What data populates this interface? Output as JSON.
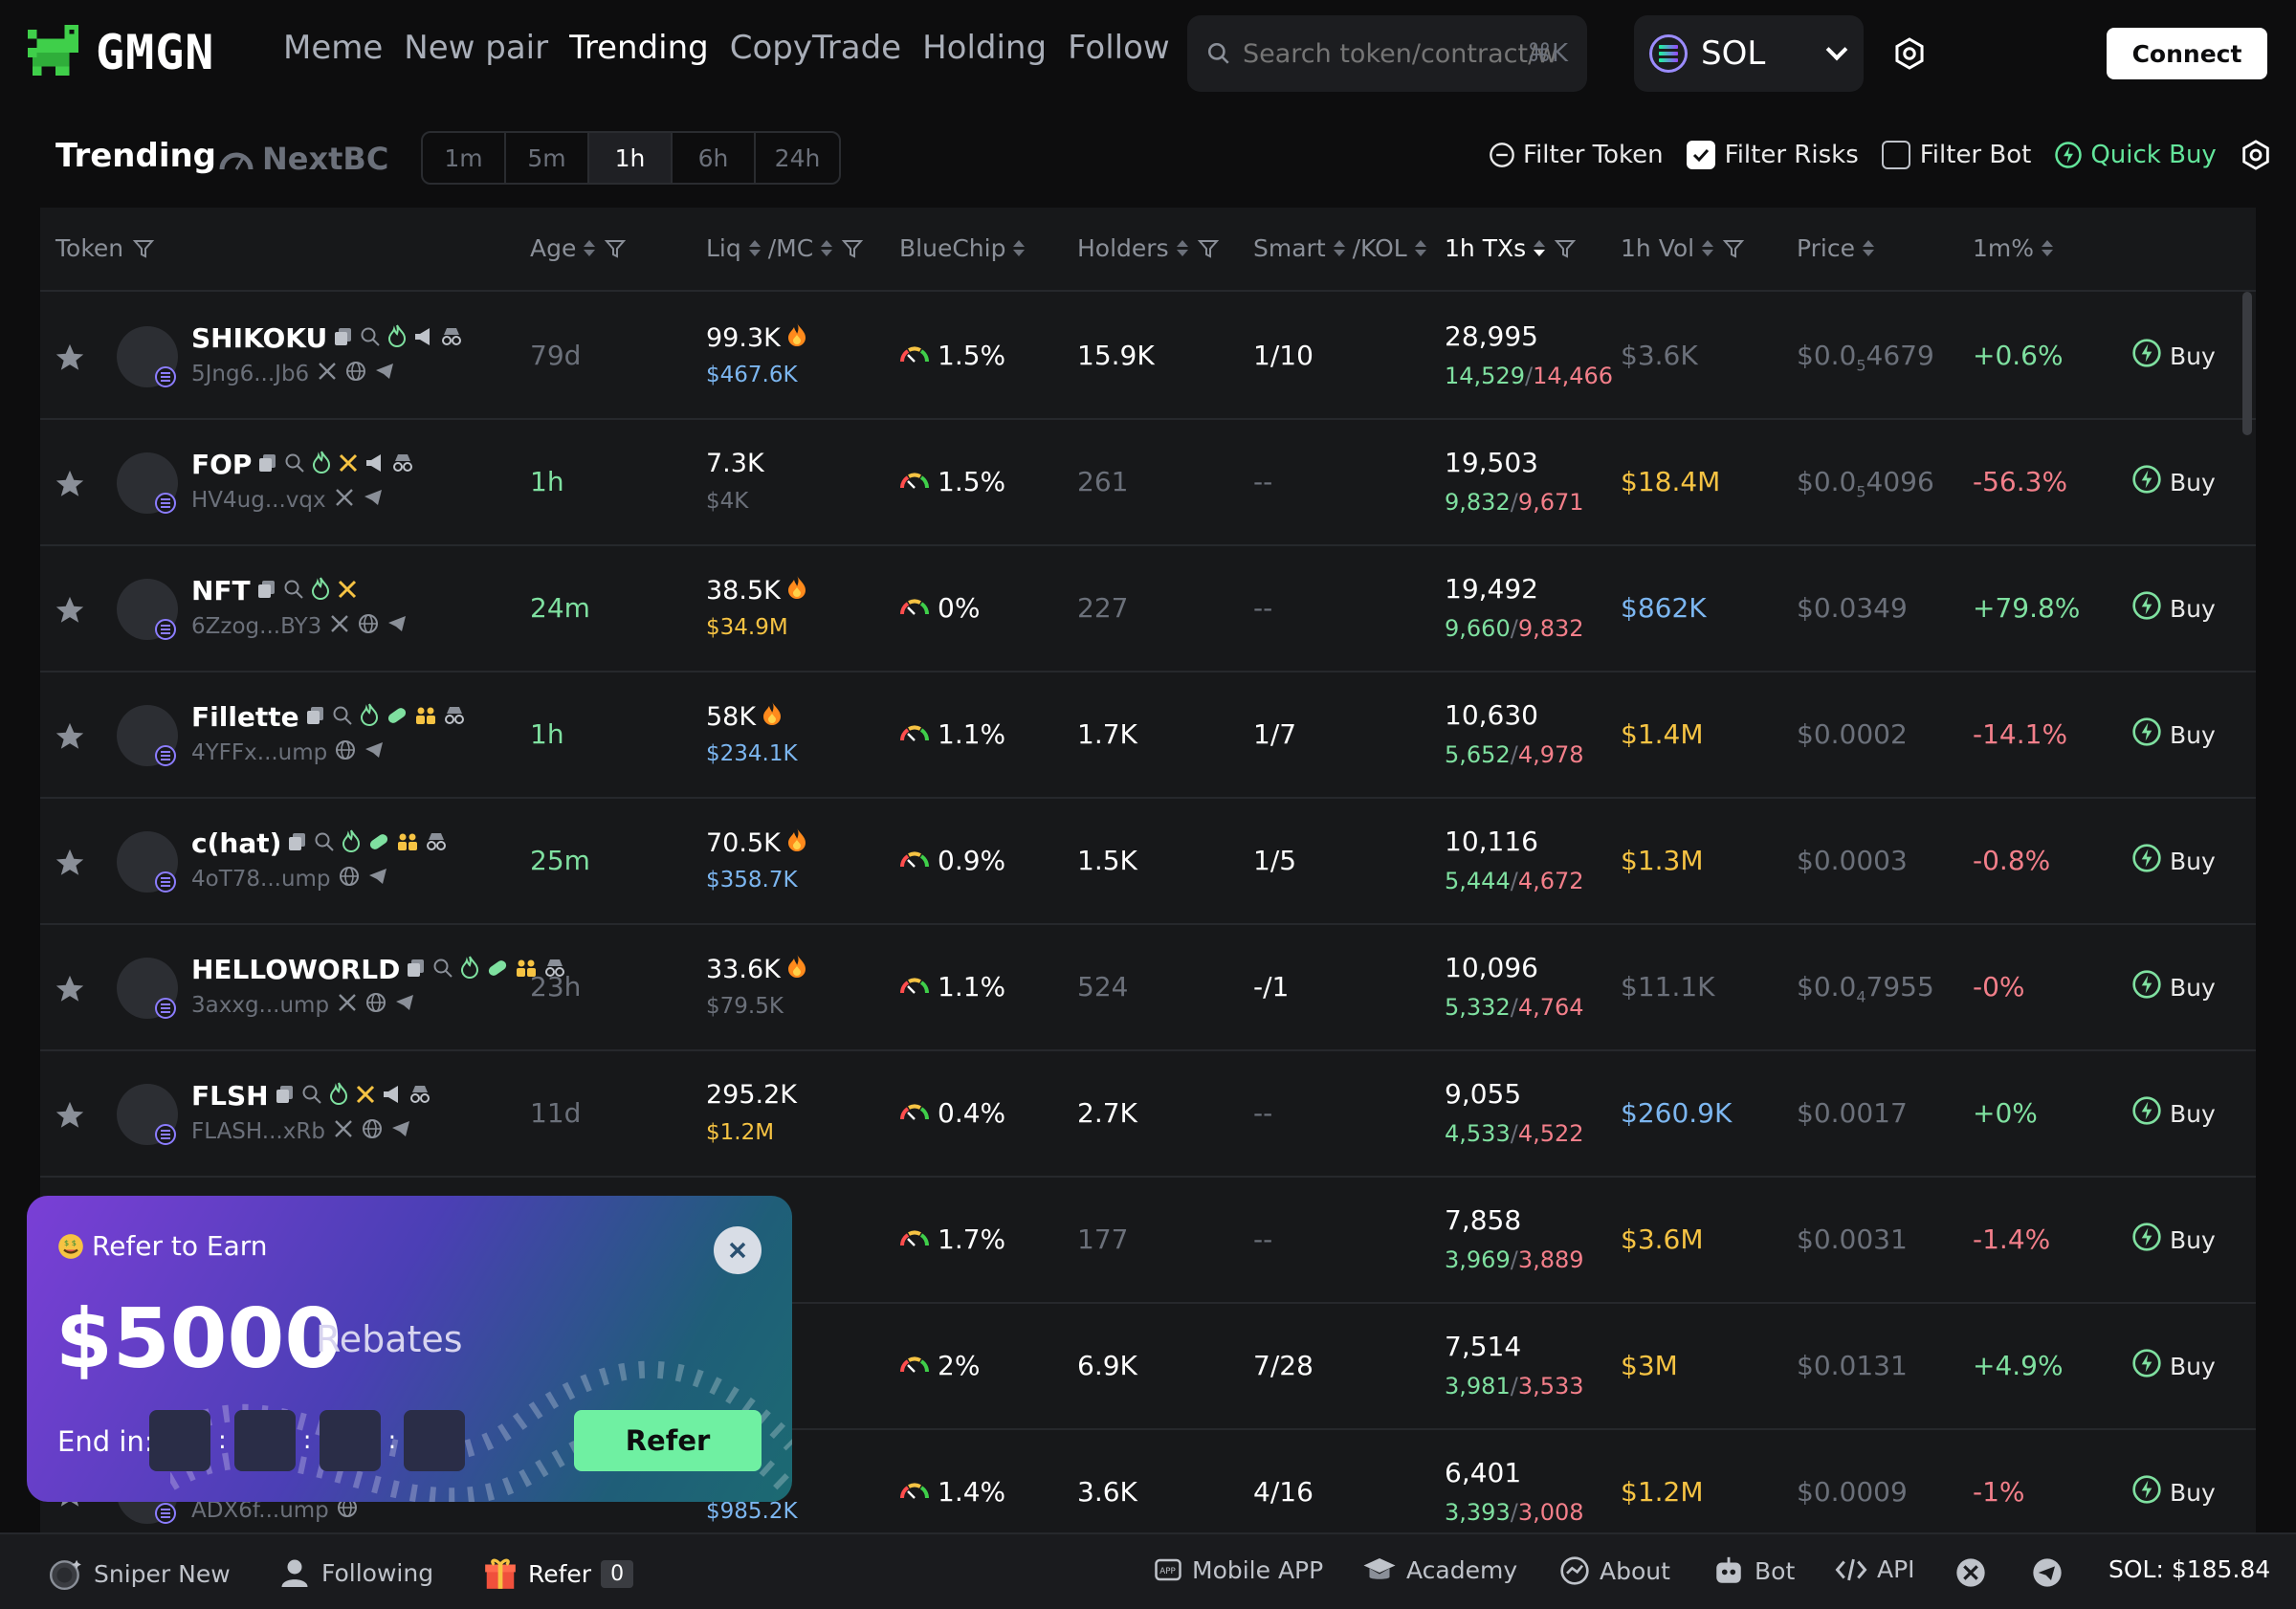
{
  "app": {
    "logo_text": "GMGN",
    "brand_green": "#3fcf4a"
  },
  "nav": {
    "links": [
      "Meme",
      "New pair",
      "Trending",
      "CopyTrade",
      "Holding",
      "Follow"
    ],
    "active": "Trending"
  },
  "search": {
    "placeholder": "Search token/contract/wallet",
    "shortcut": "⌘K"
  },
  "chain": {
    "name": "SOL"
  },
  "connect_label": "Connect",
  "page": {
    "title": "Trending",
    "nextbc": "NextBC"
  },
  "timeframes": [
    "1m",
    "5m",
    "1h",
    "6h",
    "24h"
  ],
  "timeframe_active": "1h",
  "filters": {
    "filter_token": "Filter Token",
    "filter_risks": "Filter Risks",
    "filter_risks_checked": true,
    "filter_bot": "Filter Bot",
    "filter_bot_checked": false,
    "quick_buy": "Quick Buy"
  },
  "columns": {
    "token": "Token",
    "age": "Age",
    "liq": "Liq",
    "mc": "/MC",
    "bluechip": "BlueChip",
    "holders": "Holders",
    "smart": "Smart",
    "kol": "/KOL",
    "txs": "1h TXs",
    "vol": "1h Vol",
    "price": "Price",
    "change": "1m%"
  },
  "rows": [
    {
      "name": "SHIKOKU",
      "addr": "5Jng6...Jb6",
      "age": "79d",
      "liq": "99.3K",
      "mc": "$467.6K",
      "bluechip": "1.5%",
      "holders": "15.9K",
      "smart": "1/10",
      "txs": "28,995",
      "buys": "14,529",
      "sells": "14,466",
      "vol": "$3.6K",
      "price_pre": "$0.0",
      "price_sub": "5",
      "price_post": "4679",
      "change": "+0.6%",
      "buy": "Buy"
    },
    {
      "name": "FOP",
      "addr": "HV4ug...vqx",
      "age": "1h",
      "liq": "7.3K",
      "mc": "$4K",
      "bluechip": "1.5%",
      "holders": "261",
      "smart": "--",
      "txs": "19,503",
      "buys": "9,832",
      "sells": "9,671",
      "vol": "$18.4M",
      "price_pre": "$0.0",
      "price_sub": "5",
      "price_post": "4096",
      "change": "-56.3%",
      "buy": "Buy"
    },
    {
      "name": "NFT",
      "addr": "6Zzog...BY3",
      "age": "24m",
      "liq": "38.5K",
      "mc": "$34.9M",
      "bluechip": "0%",
      "holders": "227",
      "smart": "--",
      "txs": "19,492",
      "buys": "9,660",
      "sells": "9,832",
      "vol": "$862K",
      "price_pre": "$0.0349",
      "price_sub": "",
      "price_post": "",
      "change": "+79.8%",
      "buy": "Buy"
    },
    {
      "name": "Fillette",
      "addr": "4YFFx...ump",
      "age": "1h",
      "liq": "58K",
      "mc": "$234.1K",
      "bluechip": "1.1%",
      "holders": "1.7K",
      "smart": "1/7",
      "txs": "10,630",
      "buys": "5,652",
      "sells": "4,978",
      "vol": "$1.4M",
      "price_pre": "$0.0002",
      "price_sub": "",
      "price_post": "",
      "change": "-14.1%",
      "buy": "Buy"
    },
    {
      "name": "c(hat)",
      "addr": "4oT78...ump",
      "age": "25m",
      "liq": "70.5K",
      "mc": "$358.7K",
      "bluechip": "0.9%",
      "holders": "1.5K",
      "smart": "1/5",
      "txs": "10,116",
      "buys": "5,444",
      "sells": "4,672",
      "vol": "$1.3M",
      "price_pre": "$0.0003",
      "price_sub": "",
      "price_post": "",
      "change": "-0.8%",
      "buy": "Buy"
    },
    {
      "name": "HELLOWORLD",
      "addr": "3axxg...ump",
      "age": "23h",
      "liq": "33.6K",
      "mc": "$79.5K",
      "bluechip": "1.1%",
      "holders": "524",
      "smart": "-/1",
      "txs": "10,096",
      "buys": "5,332",
      "sells": "4,764",
      "vol": "$11.1K",
      "price_pre": "$0.0",
      "price_sub": "4",
      "price_post": "7955",
      "change": "-0%",
      "buy": "Buy"
    },
    {
      "name": "FLSH",
      "addr": "FLASH...xRb",
      "age": "11d",
      "liq": "295.2K",
      "mc": "$1.2M",
      "bluechip": "0.4%",
      "holders": "2.7K",
      "smart": "--",
      "txs": "9,055",
      "buys": "4,533",
      "sells": "4,522",
      "vol": "$260.9K",
      "price_pre": "$0.0017",
      "price_sub": "",
      "price_post": "",
      "change": "+0%",
      "buy": "Buy"
    },
    {
      "name": "",
      "addr": "",
      "age": "",
      "liq": "",
      "mc": "",
      "bluechip": "1.7%",
      "holders": "177",
      "smart": "--",
      "txs": "7,858",
      "buys": "3,969",
      "sells": "3,889",
      "vol": "$3.6M",
      "price_pre": "$0.0031",
      "price_sub": "",
      "price_post": "",
      "change": "-1.4%",
      "buy": "Buy"
    },
    {
      "name": "",
      "addr": "",
      "age": "",
      "liq": "",
      "mc": "",
      "bluechip": "2%",
      "holders": "6.9K",
      "smart": "7/28",
      "txs": "7,514",
      "buys": "3,981",
      "sells": "3,533",
      "vol": "$3M",
      "price_pre": "$0.0131",
      "price_sub": "",
      "price_post": "",
      "change": "+4.9%",
      "buy": "Buy"
    },
    {
      "name": "",
      "addr": "ADX6f...ump",
      "age": "",
      "liq": "",
      "mc": "$985.2K",
      "bluechip": "1.4%",
      "holders": "3.6K",
      "smart": "4/16",
      "txs": "6,401",
      "buys": "3,393",
      "sells": "3,008",
      "vol": "$1.2M",
      "price_pre": "$0.0009",
      "price_sub": "",
      "price_post": "",
      "change": "-1%",
      "buy": "Buy"
    }
  ],
  "refer_card": {
    "title": "Refer to Earn",
    "amount": "$5000",
    "rebates": "Rebates",
    "end_label": "End in:",
    "button": "Refer",
    "countdown": [
      "",
      "",
      "",
      ""
    ]
  },
  "bottom": {
    "sniper": "Sniper New",
    "following": "Following",
    "refer": "Refer",
    "refer_count": "0",
    "mobile": "Mobile APP",
    "academy": "Academy",
    "about": "About",
    "bot": "Bot",
    "api": "API",
    "sol_price": "SOL: $185.84"
  }
}
